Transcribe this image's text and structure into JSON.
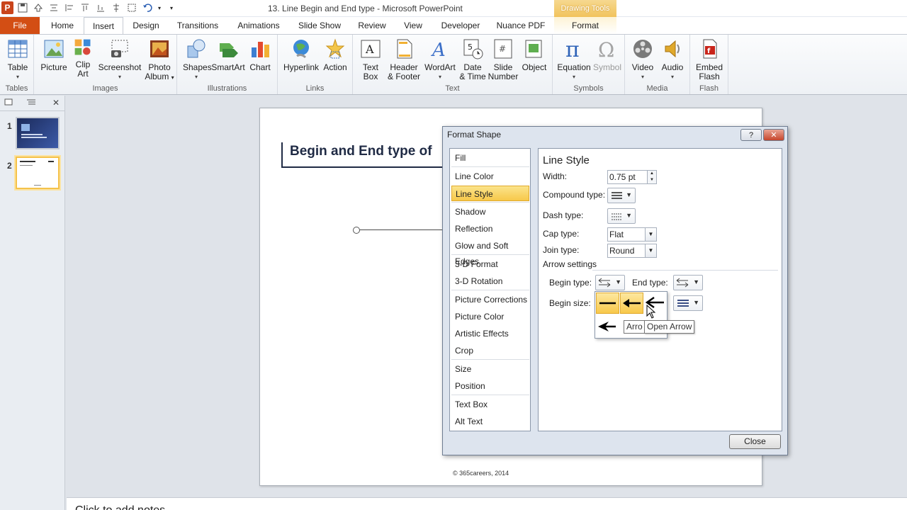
{
  "window": {
    "title": "13. Line Begin and End type - Microsoft PowerPoint",
    "context_group": "Drawing Tools",
    "app_icon": "P"
  },
  "tabs": [
    "File",
    "Home",
    "Insert",
    "Design",
    "Transitions",
    "Animations",
    "Slide Show",
    "Review",
    "View",
    "Developer",
    "Nuance PDF",
    "Format"
  ],
  "ribbon": {
    "groups": {
      "tables": "Tables",
      "images": "Images",
      "illustrations": "Illustrations",
      "links": "Links",
      "text": "Text",
      "symbols": "Symbols",
      "media": "Media",
      "flash": "Flash"
    },
    "buttons": {
      "table": "Table",
      "picture": "Picture",
      "clip_art_1": "Clip",
      "clip_art_2": "Art",
      "screenshot": "Screenshot",
      "photo_album_1": "Photo",
      "photo_album_2": "Album",
      "shapes": "Shapes",
      "smartart": "SmartArt",
      "chart": "Chart",
      "hyperlink": "Hyperlink",
      "action": "Action",
      "text_box_1": "Text",
      "text_box_2": "Box",
      "header_footer_1": "Header",
      "header_footer_2": "& Footer",
      "wordart": "WordArt",
      "date_time_1": "Date",
      "date_time_2": "& Time",
      "slide_number_1": "Slide",
      "slide_number_2": "Number",
      "object": "Object",
      "equation": "Equation",
      "symbol": "Symbol",
      "video": "Video",
      "audio": "Audio",
      "embed_flash_1": "Embed",
      "embed_flash_2": "Flash"
    }
  },
  "slides_pane": {
    "slide_numbers": [
      "1",
      "2"
    ]
  },
  "slide": {
    "title": "Begin and End type of",
    "footer": "© 365careers, 2014"
  },
  "notes": {
    "placeholder": "Click to add notes"
  },
  "dialog": {
    "title": "Format Shape",
    "help_glyph": "?",
    "close_glyph": "✕",
    "categories": [
      "Fill",
      "Line Color",
      "Line Style",
      "Shadow",
      "Reflection",
      "Glow and Soft Edges",
      "3-D Format",
      "3-D Rotation",
      "Picture Corrections",
      "Picture Color",
      "Artistic Effects",
      "Crop",
      "Size",
      "Position",
      "Text Box",
      "Alt Text"
    ],
    "selected_category": "Line Style",
    "panel": {
      "heading": "Line Style",
      "width_label": "Width:",
      "width_value": "0.75 pt",
      "compound_label": "Compound type:",
      "dash_label": "Dash type:",
      "cap_label": "Cap type:",
      "cap_value": "Flat",
      "join_label": "Join type:",
      "join_value": "Round",
      "arrow_settings": "Arrow settings",
      "begin_type_label": "Begin type:",
      "end_type_label": "End type:",
      "begin_size_label": "Begin size:"
    },
    "tooltip": "Open Arrow",
    "tooltip_behind": "Arro",
    "close_button": "Close"
  },
  "colors": {
    "file_tab": "#d34e14",
    "highlight": "#f7c84a",
    "context_tab": "#f1c35c",
    "dialog_bg": "#dde4ee"
  }
}
